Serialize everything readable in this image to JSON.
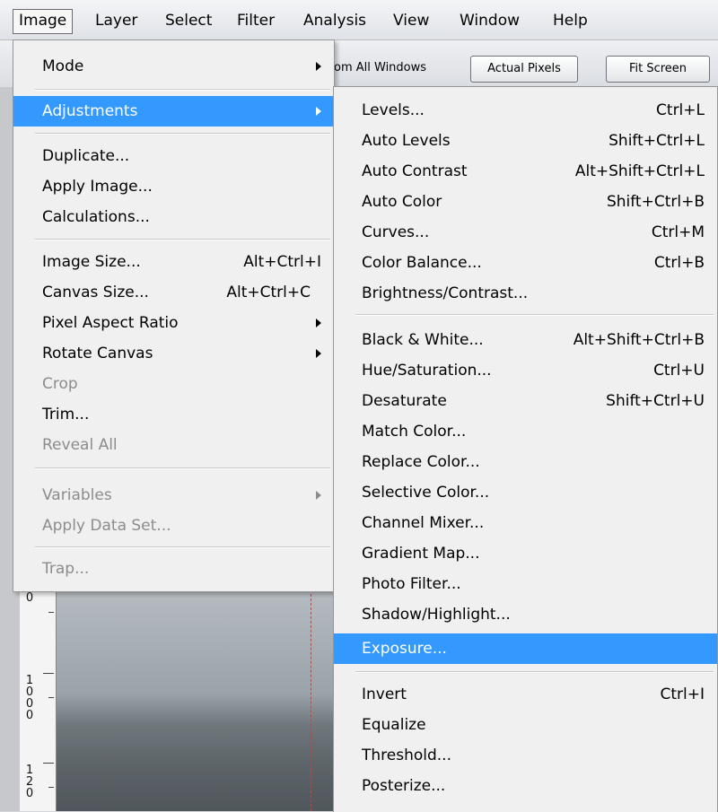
{
  "menubar": {
    "items": [
      "Image",
      "Layer",
      "Select",
      "Filter",
      "Analysis",
      "View",
      "Window",
      "Help"
    ]
  },
  "options": {
    "partial_label": "om All Windows",
    "actual_pixels": "Actual Pixels",
    "fit_screen": "Fit Screen"
  },
  "image_menu": {
    "items": [
      {
        "label": "Mode",
        "submenu": true
      },
      {
        "label": "Adjustments",
        "submenu": true,
        "highlighted": true
      },
      {
        "label": "Duplicate..."
      },
      {
        "label": "Apply Image..."
      },
      {
        "label": "Calculations..."
      },
      {
        "label": "Image Size...",
        "shortcut": "Alt+Ctrl+I"
      },
      {
        "label": "Canvas Size...",
        "shortcut": "Alt+Ctrl+C"
      },
      {
        "label": "Pixel Aspect Ratio",
        "submenu": true
      },
      {
        "label": "Rotate Canvas",
        "submenu": true
      },
      {
        "label": "Crop",
        "disabled": true
      },
      {
        "label": "Trim..."
      },
      {
        "label": "Reveal All",
        "disabled": true
      },
      {
        "label": "Variables",
        "submenu": true,
        "disabled": true
      },
      {
        "label": "Apply Data Set...",
        "disabled": true
      },
      {
        "label": "Trap...",
        "disabled": true
      }
    ]
  },
  "adjustments_menu": {
    "items": [
      {
        "label": "Levels...",
        "shortcut": "Ctrl+L"
      },
      {
        "label": "Auto Levels",
        "shortcut": "Shift+Ctrl+L"
      },
      {
        "label": "Auto Contrast",
        "shortcut": "Alt+Shift+Ctrl+L"
      },
      {
        "label": "Auto Color",
        "shortcut": "Shift+Ctrl+B"
      },
      {
        "label": "Curves...",
        "shortcut": "Ctrl+M"
      },
      {
        "label": "Color Balance...",
        "shortcut": "Ctrl+B"
      },
      {
        "label": "Brightness/Contrast..."
      },
      {
        "label": "Black & White...",
        "shortcut": "Alt+Shift+Ctrl+B"
      },
      {
        "label": "Hue/Saturation...",
        "shortcut": "Ctrl+U"
      },
      {
        "label": "Desaturate",
        "shortcut": "Shift+Ctrl+U"
      },
      {
        "label": "Match Color..."
      },
      {
        "label": "Replace Color..."
      },
      {
        "label": "Selective Color..."
      },
      {
        "label": "Channel Mixer..."
      },
      {
        "label": "Gradient Map..."
      },
      {
        "label": "Photo Filter..."
      },
      {
        "label": "Shadow/Highlight..."
      },
      {
        "label": "Exposure...",
        "highlighted": true
      },
      {
        "label": "Invert",
        "shortcut": "Ctrl+I"
      },
      {
        "label": "Equalize"
      },
      {
        "label": "Threshold..."
      },
      {
        "label": "Posterize..."
      }
    ]
  },
  "ruler": {
    "labels": [
      "0",
      "1000",
      "120"
    ]
  },
  "colors": {
    "highlight": "#3399ff",
    "menu_bg": "#f0f0f0",
    "disabled_text": "#8c8c8c"
  }
}
